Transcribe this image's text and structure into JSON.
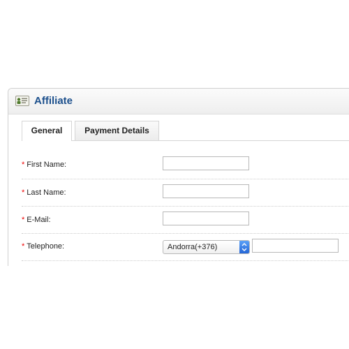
{
  "panel": {
    "title": "Affiliate",
    "icon": "affiliate-card-icon"
  },
  "tabs": [
    {
      "label": "General",
      "active": true
    },
    {
      "label": "Payment Details",
      "active": false
    }
  ],
  "form": {
    "required_marker": "*",
    "fields": [
      {
        "label": "First Name:",
        "value": "",
        "required": true
      },
      {
        "label": "Last Name:",
        "value": "",
        "required": true
      },
      {
        "label": "E-Mail:",
        "value": "",
        "required": true
      },
      {
        "label": "Telephone:",
        "required": true,
        "country_code": "Andorra(+376)",
        "number": ""
      }
    ]
  },
  "colors": {
    "title": "#1b4f8c",
    "required": "#ee0000",
    "select_arrow": "#2f74e0"
  }
}
